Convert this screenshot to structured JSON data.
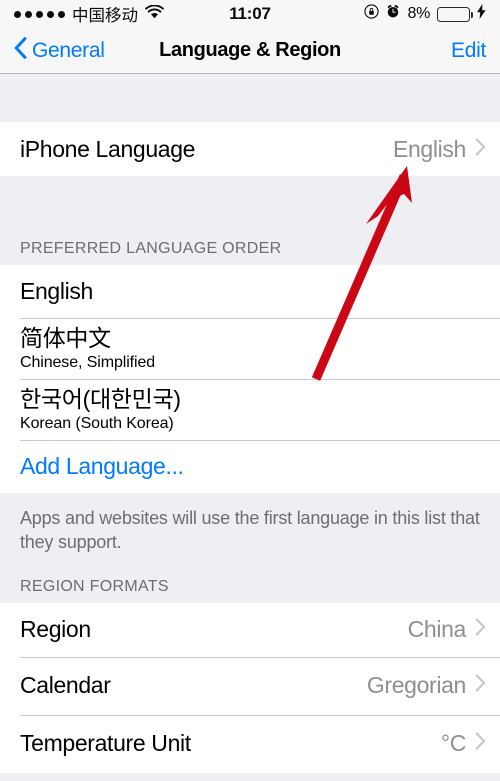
{
  "status_bar": {
    "signal_dots": 5,
    "carrier": "中国移动",
    "wifi_icon": "wifi-icon",
    "time": "11:07",
    "rotation_lock_icon": "rotation-lock-icon",
    "alarm_icon": "alarm-clock-icon",
    "battery_percent": "8%",
    "battery_level": 8,
    "battery_fill_color": "#FDCC0D",
    "charging_icon": "lightning-bolt-icon"
  },
  "nav": {
    "back_label": "General",
    "back_icon": "chevron-left-icon",
    "title": "Language & Region",
    "edit_label": "Edit",
    "tint_color": "#007AFF"
  },
  "sections": {
    "iphone_language": {
      "rows": [
        {
          "title": "iPhone Language",
          "value": "English",
          "accessory": "chevron-right-icon"
        }
      ]
    },
    "preferred_language_order": {
      "header": "PREFERRED LANGUAGE ORDER",
      "rows": [
        {
          "primary": "English",
          "secondary": ""
        },
        {
          "primary": "简体中文",
          "secondary": "Chinese, Simplified"
        },
        {
          "primary": "한국어(대한민국)",
          "secondary": "Korean (South Korea)"
        }
      ],
      "add_language_label": "Add Language...",
      "footer": "Apps and websites will use the first language in this list that they support."
    },
    "region_formats": {
      "header": "REGION FORMATS",
      "rows": [
        {
          "title": "Region",
          "value": "China",
          "accessory": "chevron-right-icon"
        },
        {
          "title": "Calendar",
          "value": "Gregorian",
          "accessory": "chevron-right-icon"
        },
        {
          "title": "Temperature Unit",
          "value": "°C",
          "accessory": "chevron-right-icon"
        }
      ]
    }
  },
  "annotation": {
    "arrow_icon": "red-arrow-annotation",
    "color": "#CC0715",
    "points_to": "English"
  }
}
